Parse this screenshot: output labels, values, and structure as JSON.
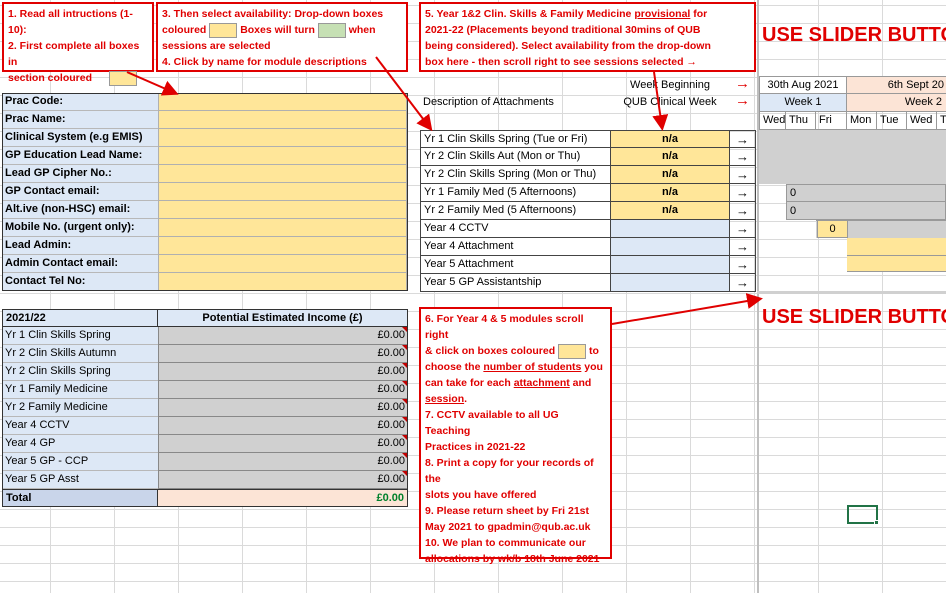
{
  "instructions": {
    "box1_line1": "1. Read all intructions (1-10):",
    "box1_line2": "2. First complete all boxes in",
    "box1_line3": "section coloured",
    "box2_line1": "3. Then select availability: Drop-down boxes",
    "box2_line2a": "coloured",
    "box2_line2b": "Boxes will turn",
    "box2_line2c": "when",
    "box2_line3": "sessions are selected",
    "box2_line4": "4. Click by name for module descriptions",
    "box5_line1a": "5. Year 1&2 Clin. Skills & Family Medicine ",
    "box5_line1b": "provisional",
    "box5_line1c": " for",
    "box5_line2": "2021-22 (Placements beyond traditional 30mins of QUB",
    "box5_line3": "being considered). Select availability from the drop-down",
    "box5_line4": "box here - then scroll right to see sessions selected →",
    "box6_line1": "6. For Year 4 & 5 modules scroll right",
    "box6_line2a": "& click on boxes coloured",
    "box6_line2b": "to",
    "box6_line3a": "choose the ",
    "box6_line3b": "number of students",
    "box6_line3c": " you",
    "box6_line4a": "can take for each ",
    "box6_line4b": "attachment",
    "box6_line4c": " and",
    "box6_line5a": "session",
    "box6_line5b": ".",
    "box6_line6": "7. CCTV available to all UG Teaching",
    "box6_line7": "Practices in 2021-22",
    "box6_line8": "8. Print a copy for your records of the",
    "box6_line9": "slots you have offered",
    "box6_line10": "9. Please return sheet by Fri 21st",
    "box6_line11": "May 2021 to gpadmin@qub.ac.uk",
    "box6_line12": "10. We plan to communicate our",
    "box6_line13": "allocations by wk/b 18th June 2021"
  },
  "slider_text_top": "USE SLIDER BUTTO",
  "slider_text_bottom": "USE SLIDER BUTTO",
  "practice_fields": [
    {
      "label": "Prac Code:",
      "value": ""
    },
    {
      "label": "Prac Name:",
      "value": ""
    },
    {
      "label": "Clinical System (e.g EMIS)",
      "value": ""
    },
    {
      "label": "GP Education Lead Name:",
      "value": ""
    },
    {
      "label": "Lead GP Cipher No.:",
      "value": ""
    },
    {
      "label": "GP Contact email:",
      "value": ""
    },
    {
      "label": "Alt.ive (non-HSC) email:",
      "value": ""
    },
    {
      "label": "Mobile No. (urgent only):",
      "value": ""
    },
    {
      "label": "Lead Admin:",
      "value": ""
    },
    {
      "label": "Admin Contact email:",
      "value": ""
    },
    {
      "label": "Contact Tel No:",
      "value": ""
    }
  ],
  "attachments": {
    "week_beginning_label": "Week Beginning",
    "description_header": "Description of Attachments",
    "qub_week_label": "QUB Clinical Week",
    "arrow_glyph": "→",
    "rows": [
      {
        "name": "Yr 1 Clin Skills Spring (Tue or Fri)",
        "value": "n/a"
      },
      {
        "name": "Yr 2 Clin Skills Aut (Mon or Thu)",
        "value": "n/a"
      },
      {
        "name": "Yr 2 Clin Skills Spring (Mon or Thu)",
        "value": "n/a"
      },
      {
        "name": "Yr 1 Family Med (5 Afternoons)",
        "value": "n/a"
      },
      {
        "name": "Yr 2 Family Med (5 Afternoons)",
        "value": "n/a"
      },
      {
        "name": "Year 4 CCTV",
        "value": ""
      },
      {
        "name": "Year 4 Attachment",
        "value": ""
      },
      {
        "name": "Year 5 Attachment",
        "value": ""
      },
      {
        "name": "Year 5 GP Assistantship",
        "value": ""
      }
    ]
  },
  "calendar": {
    "weeks": [
      {
        "date": "30th Aug 2021",
        "label": "Week 1",
        "days": [
          "Wed",
          "Thu",
          "Fri"
        ]
      },
      {
        "date": "6th Sept 20",
        "label": "Week 2",
        "days": [
          "Mon",
          "Tue",
          "Wed",
          "T"
        ]
      }
    ],
    "cell_values": [
      "0",
      "0",
      "0"
    ]
  },
  "income": {
    "year_header": "2021/22",
    "income_header": "Potential Estimated Income (£)",
    "rows": [
      {
        "name": "Yr 1 Clin Skills Spring",
        "value": "£0.00"
      },
      {
        "name": "Yr 2 Clin Skills Autumn",
        "value": "£0.00"
      },
      {
        "name": "Yr 2 Clin Skills Spring",
        "value": "£0.00"
      },
      {
        "name": "Yr 1  Family Medicine",
        "value": "£0.00"
      },
      {
        "name": "Yr 2  Family Medicine",
        "value": "£0.00"
      },
      {
        "name": "Year 4 CCTV",
        "value": "£0.00"
      },
      {
        "name": "Year 4 GP",
        "value": "£0.00"
      },
      {
        "name": "Year 5 GP - CCP",
        "value": "£0.00"
      },
      {
        "name": "Year 5 GP Asst",
        "value": "£0.00"
      }
    ],
    "total_label": "Total",
    "total_value": "£0.00"
  },
  "colors": {
    "instruction_red": "#e00000",
    "input_yellow": "#ffe699",
    "selected_green": "#c6e0b4",
    "label_blue": "#dde8f6",
    "total_pink": "#fce4d6",
    "total_green": "#00802b"
  }
}
